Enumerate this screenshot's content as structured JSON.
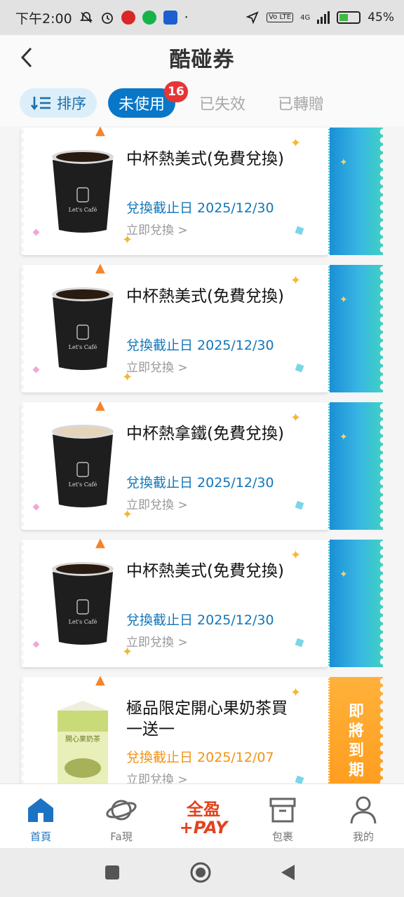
{
  "status_bar": {
    "time": "下午2:00",
    "network": "4G",
    "volte": "Vo LTE",
    "battery": "45%"
  },
  "header": {
    "title": "酷碰券",
    "back_icon": "chevron-left-icon"
  },
  "filters": {
    "sort_label": "排序",
    "tabs": [
      {
        "label": "未使用",
        "active": true,
        "badge": "16"
      },
      {
        "label": "已失效",
        "active": false
      },
      {
        "label": "已轉贈",
        "active": false
      }
    ]
  },
  "coupons": [
    {
      "title": "中杯熱美式(免費兌換)",
      "expiry": "兌換截止日 2025/12/30",
      "action": "立即兌換 >",
      "product": "black-coffee-cup",
      "side": "blue"
    },
    {
      "title": "中杯熱美式(免費兌換)",
      "expiry": "兌換截止日 2025/12/30",
      "action": "立即兌換 >",
      "product": "black-coffee-cup",
      "side": "blue"
    },
    {
      "title": "中杯熱拿鐵(免費兌換)",
      "expiry": "兌換截止日 2025/12/30",
      "action": "立即兌換 >",
      "product": "latte-cup",
      "side": "blue"
    },
    {
      "title": "中杯熱美式(免費兌換)",
      "expiry": "兌換截止日 2025/12/30",
      "action": "立即兌換 >",
      "product": "black-coffee-cup",
      "side": "blue"
    },
    {
      "title": "極品限定開心果奶茶買一送一",
      "expiry": "兌換截止日 2025/12/07",
      "action": "立即兌換 >",
      "product": "pistachio-milk-tea-carton",
      "side": "orange",
      "side_label": "即將到期",
      "carton_text": "開心果奶茶"
    }
  ],
  "bottom_nav": [
    {
      "label": "首頁",
      "icon": "home-icon",
      "active": true
    },
    {
      "label": "Fa現",
      "icon": "planet-icon",
      "active": false
    },
    {
      "label": "全盈+PAY",
      "icon": "pay-logo",
      "active": false
    },
    {
      "label": "包裹",
      "icon": "package-icon",
      "active": false
    },
    {
      "label": "我的",
      "icon": "person-icon",
      "active": false
    }
  ],
  "pay_logo": {
    "line1": "全盈",
    "line2": "+PAY"
  },
  "colors": {
    "primary_blue": "#0877c8",
    "badge_red": "#e73535",
    "expiry_blue": "#1276b9",
    "expiry_orange": "#f39213",
    "pay_red": "#e2421e"
  }
}
